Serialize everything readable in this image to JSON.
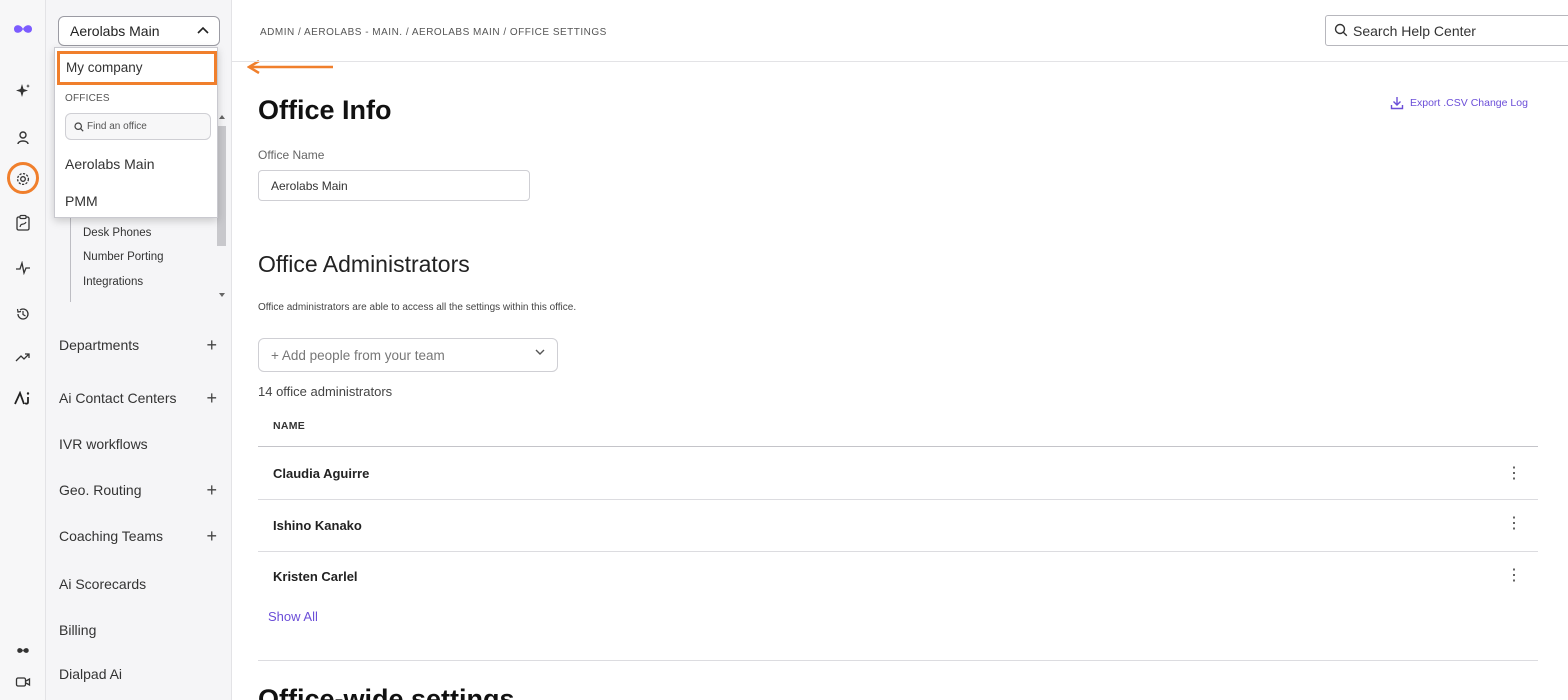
{
  "colors": {
    "accent": "#6b4ed8",
    "annotation": "#f07f2c",
    "logo": "#7c5cff"
  },
  "rail": {
    "icons": [
      "logo-icon",
      "sparkle-icon",
      "person-icon",
      "gear-icon",
      "clipboard-route-icon",
      "activity-icon",
      "history-icon",
      "trend-up-icon",
      "ai-agent-icon",
      "dialpad-logo-small-icon",
      "video-icon"
    ]
  },
  "nav": {
    "office_select": "Aerolabs Main",
    "subnav": [
      "Desk Phones",
      "Number Porting",
      "Integrations"
    ],
    "items": [
      {
        "label": "Departments",
        "plus": "+"
      },
      {
        "label": "Ai Contact Centers",
        "plus": "+"
      },
      {
        "label": "IVR workflows",
        "plus": ""
      },
      {
        "label": "Geo. Routing",
        "plus": "+"
      },
      {
        "label": "Coaching Teams",
        "plus": "+"
      },
      {
        "label": "Ai Scorecards",
        "plus": ""
      },
      {
        "label": "Billing",
        "plus": ""
      },
      {
        "label": "Dialpad Ai",
        "plus": ""
      }
    ]
  },
  "dropdown": {
    "my_company": "My company",
    "heading": "OFFICES",
    "search_placeholder": "Find an office",
    "options": [
      "Aerolabs Main",
      "PMM"
    ]
  },
  "topbar": {
    "breadcrumb": "ADMIN / AEROLABS - MAIN. / AEROLABS MAIN / OFFICE SETTINGS",
    "search_placeholder": "Search Help Center"
  },
  "office_info": {
    "title": "Office Info",
    "export_label": "Export .CSV Change Log",
    "name_label": "Office Name",
    "name_value": "Aerolabs Main"
  },
  "admins": {
    "title": "Office Administrators",
    "description": "Office administrators are able to access all the settings within this office.",
    "add_placeholder": "+ Add people from your team",
    "count": "14 office administrators",
    "column_name": "NAME",
    "rows": [
      "Claudia Aguirre",
      "Ishino Kanako",
      "Kristen Carlel"
    ],
    "show_all": "Show All"
  },
  "next_section_title": "Office-wide settings"
}
